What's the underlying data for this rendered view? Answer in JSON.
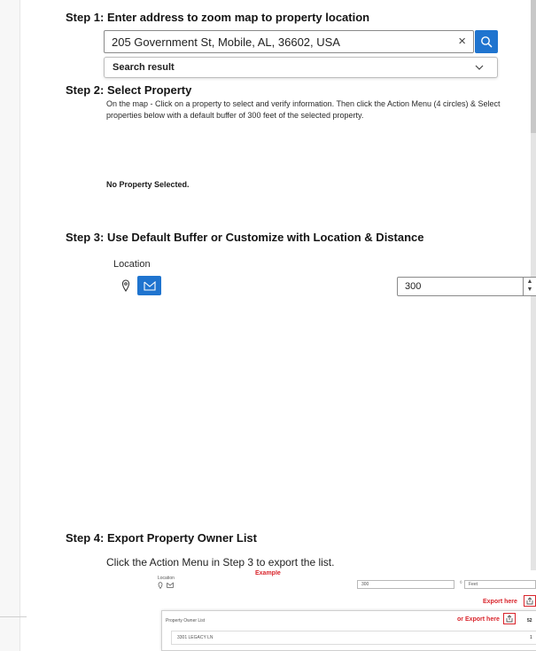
{
  "step1": {
    "title": "Step 1: Enter address to zoom map to property location",
    "search_value": "205 Government St, Mobile, AL, 36602, USA",
    "clear_symbol": "×",
    "result_label": "Search result"
  },
  "step2": {
    "title": "Step 2: Select Property",
    "description": "On the map - Click on a property to select and verify information.  Then click the Action Menu (4 circles) & Select properties below with a default buffer of 300 feet of the selected property.",
    "no_selection": "No Property Selected."
  },
  "step3": {
    "title": "Step 3: Use Default Buffer or Customize with Location & Distance",
    "location_label": "Location",
    "distance_value": "300"
  },
  "step4": {
    "title": "Step 4: Export Property Owner List",
    "description": "Click the Action Menu in Step 3 to export the list.",
    "example": {
      "heading": "Example",
      "location_label": "Location",
      "distance_value": "300",
      "unit": "Feet",
      "export_here": "Export here",
      "or_export_here": "or Export here",
      "list_title": "Property Owner List",
      "count_partial": "52",
      "row_address": "3301 LEGACY LN",
      "row_value": "1"
    }
  },
  "colors": {
    "accent": "#1f74cf",
    "annotation_red": "#d9242b"
  },
  "icons": [
    "search-icon",
    "chevron-down-icon",
    "pin-icon",
    "polygon-icon",
    "export-icon"
  ]
}
